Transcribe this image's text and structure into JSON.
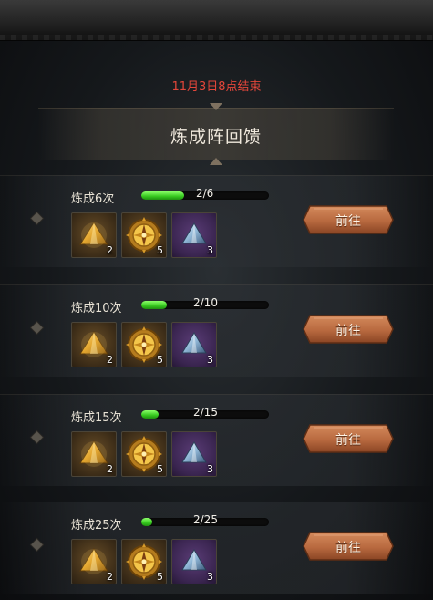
{
  "event": {
    "end_time": "11月3日8点结束",
    "title": "炼成阵回馈"
  },
  "colors": {
    "end_time_text": "#e2463a",
    "progress_fill": "#36c81e",
    "button": "#b8693f"
  },
  "tasks": [
    {
      "label": "炼成6次",
      "progress_text": "2/6",
      "progress_fraction": 0.333,
      "rewards": [
        {
          "icon": "gold-pyramid-icon",
          "count": "2"
        },
        {
          "icon": "golden-compass-icon",
          "count": "5"
        },
        {
          "icon": "blue-crystal-icon",
          "count": "3"
        }
      ],
      "button": "前往"
    },
    {
      "label": "炼成10次",
      "progress_text": "2/10",
      "progress_fraction": 0.2,
      "rewards": [
        {
          "icon": "gold-pyramid-icon",
          "count": "2"
        },
        {
          "icon": "golden-compass-icon",
          "count": "5"
        },
        {
          "icon": "blue-crystal-icon",
          "count": "3"
        }
      ],
      "button": "前往"
    },
    {
      "label": "炼成15次",
      "progress_text": "2/15",
      "progress_fraction": 0.133,
      "rewards": [
        {
          "icon": "gold-pyramid-icon",
          "count": "2"
        },
        {
          "icon": "golden-compass-icon",
          "count": "5"
        },
        {
          "icon": "blue-crystal-icon",
          "count": "3"
        }
      ],
      "button": "前往"
    },
    {
      "label": "炼成25次",
      "progress_text": "2/25",
      "progress_fraction": 0.08,
      "rewards": [
        {
          "icon": "gold-pyramid-icon",
          "count": "2"
        },
        {
          "icon": "golden-compass-icon",
          "count": "5"
        },
        {
          "icon": "blue-crystal-icon",
          "count": "3"
        }
      ],
      "button": "前往"
    }
  ]
}
